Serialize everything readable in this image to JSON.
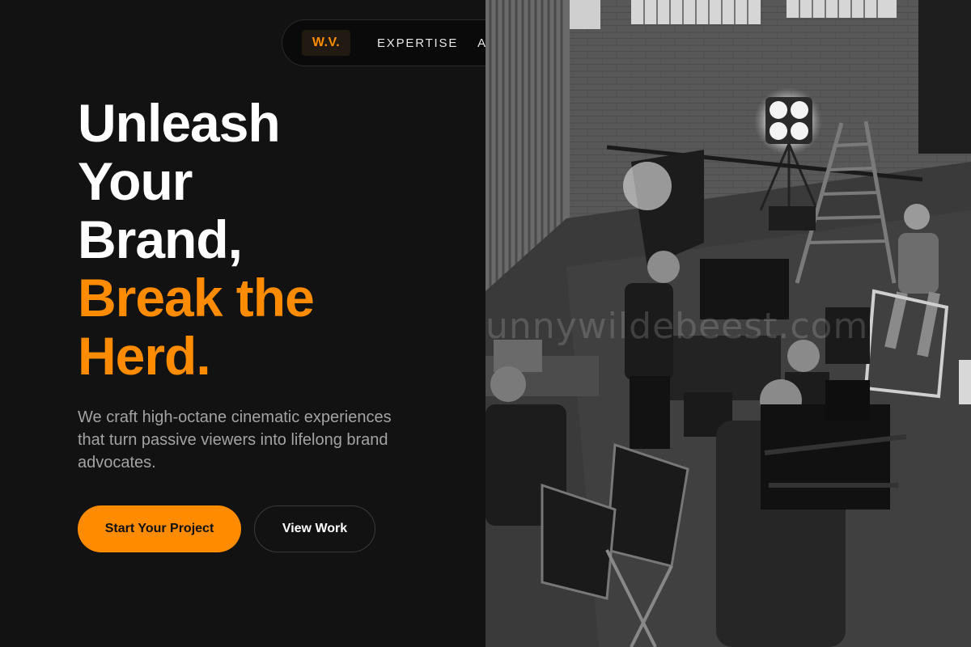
{
  "nav": {
    "logo": "W.V.",
    "links": [
      "EXPERTISE",
      "ABO"
    ]
  },
  "hero": {
    "headline_white": [
      "Unleash",
      "Your",
      "Brand,"
    ],
    "headline_orange": [
      "Break the",
      "Herd."
    ],
    "subtext": "We craft high-octane cinematic experiences that turn passive viewers into lifelong brand advocates.",
    "primary_button": "Start Your Project",
    "secondary_button": "View Work"
  },
  "photo": {
    "watermark": "unnywildebeest.com",
    "description": "black and white film set with crew"
  },
  "colors": {
    "accent": "#ff8c00",
    "background": "#121212",
    "subtext": "#a3a3a3"
  }
}
